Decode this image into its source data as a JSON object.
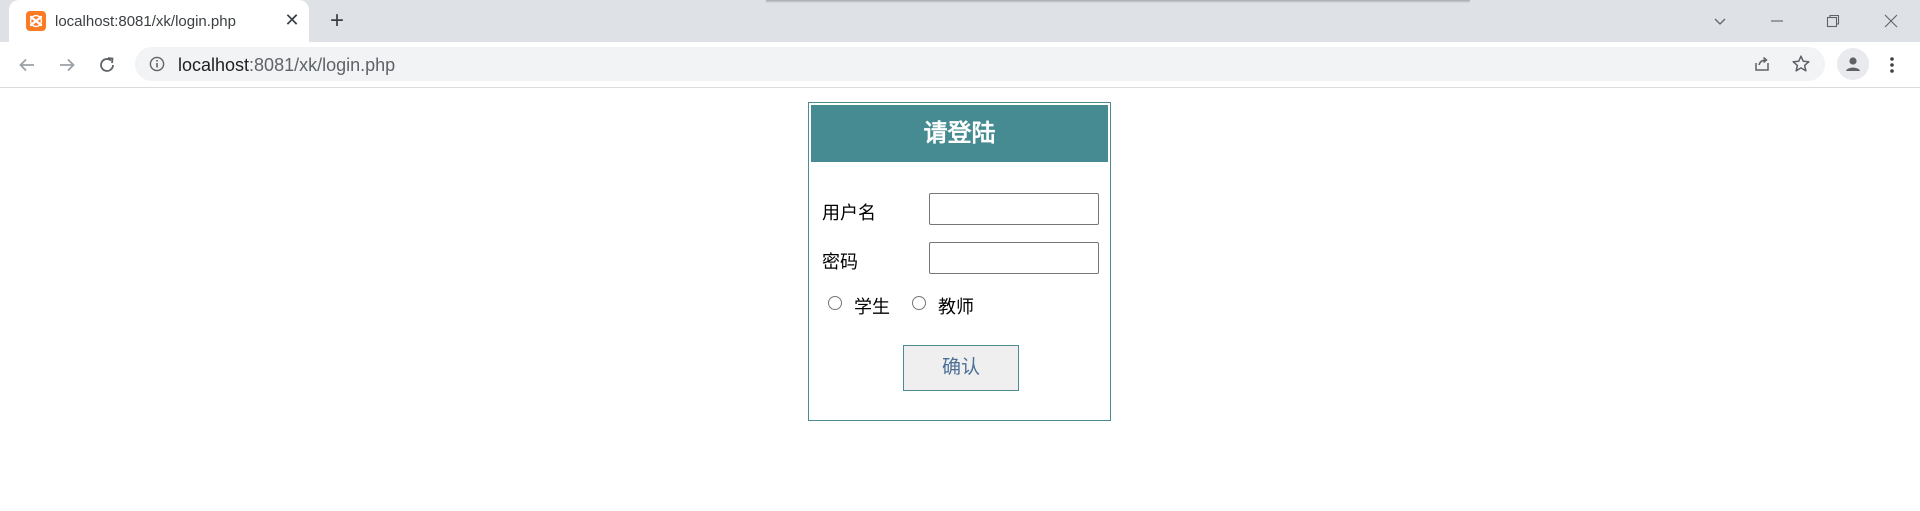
{
  "browser": {
    "tab": {
      "title": "localhost:8081/xk/login.php",
      "close_glyph": "✕"
    },
    "new_tab_glyph": "+",
    "url": {
      "host": "localhost",
      "rest": ":8081/xk/login.php"
    },
    "icons": {
      "favicon": "xampp-icon",
      "back": "back-arrow-icon",
      "forward": "forward-arrow-icon",
      "reload": "reload-icon",
      "info": "info-icon",
      "share": "share-icon",
      "bookmark": "star-icon",
      "profile": "profile-icon",
      "menu": "kebab-menu-icon"
    }
  },
  "login": {
    "title": "请登陆",
    "username_label": "用户名",
    "username_value": "",
    "password_label": "密码",
    "password_value": "",
    "role_options": [
      {
        "label": "学生",
        "checked": false
      },
      {
        "label": "教师",
        "checked": false
      }
    ],
    "submit_label": "确认"
  },
  "colors": {
    "header_bg": "#458b91",
    "border": "#4b8b91",
    "favicon": "#fb7a24",
    "tabstrip_bg": "#dee1e6",
    "omnibox_bg": "#f1f3f4"
  }
}
